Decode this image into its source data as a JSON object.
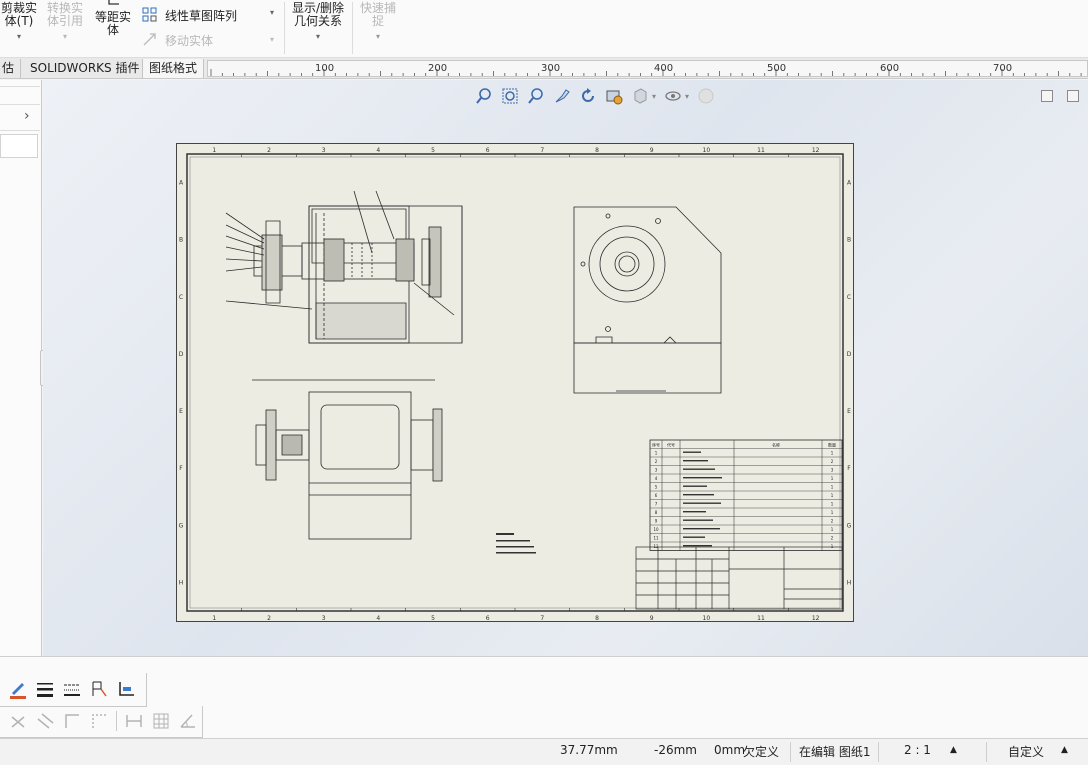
{
  "toolbar": {
    "trim": {
      "line1": "剪裁实",
      "line2": "体(T)"
    },
    "convert": {
      "line1": "转换实",
      "line2": "体引用"
    },
    "offset": {
      "line1": "等距实",
      "line2": "体"
    },
    "linear_pattern": "线性草图阵列",
    "move_entities": "移动实体",
    "relations": {
      "line1": "显示/删除",
      "line2": "几何关系"
    },
    "quick_snap": {
      "line1": "快速捕",
      "line2": "捉"
    }
  },
  "tabs": [
    {
      "label": "估"
    },
    {
      "label": "SOLIDWORKS 插件"
    },
    {
      "label": "图纸格式"
    }
  ],
  "ruler": {
    "labels": [
      "100",
      "200",
      "300",
      "400",
      "500",
      "600",
      "700"
    ]
  },
  "drawing": {
    "border_numbers": [
      "1",
      "2",
      "3",
      "4",
      "5",
      "6",
      "7",
      "8",
      "9",
      "10",
      "11",
      "12"
    ],
    "border_letters": [
      "A",
      "B",
      "C",
      "D",
      "E",
      "F",
      "G",
      "H"
    ],
    "bom": {
      "headers": [
        "序号",
        "代号",
        "名称",
        "数量"
      ],
      "rows": [
        [
          "1",
          "1",
          ""
        ],
        [
          "2",
          "2",
          ""
        ],
        [
          "3",
          "3",
          ""
        ],
        [
          "4",
          "1",
          ""
        ],
        [
          "5",
          "1",
          ""
        ],
        [
          "6",
          "1",
          ""
        ],
        [
          "7",
          "1",
          ""
        ],
        [
          "8",
          "1",
          ""
        ],
        [
          "9",
          "2",
          ""
        ],
        [
          "10",
          "1",
          ""
        ],
        [
          "11",
          "2",
          ""
        ],
        [
          "12",
          "1",
          ""
        ]
      ]
    }
  },
  "status": {
    "x": "37.77mm",
    "y": "-26mm",
    "z": "0mm",
    "state": "欠定义",
    "editing": "在编辑 图纸1",
    "scale": "2 : 1",
    "units": "自定义"
  },
  "colors": {
    "sheet_paper": "#ebebe2",
    "drawing_line": "#2a2a2a",
    "canvas_bg": "#e4e9f0"
  },
  "icons": {
    "heads_up": [
      "zoom-to-fit-icon",
      "zoom-area-icon",
      "zoom-in-out-icon",
      "previous-view-icon",
      "rotate-icon",
      "section-view-icon",
      "display-style-icon",
      "hide-show-icon",
      "appearance-icon"
    ]
  }
}
